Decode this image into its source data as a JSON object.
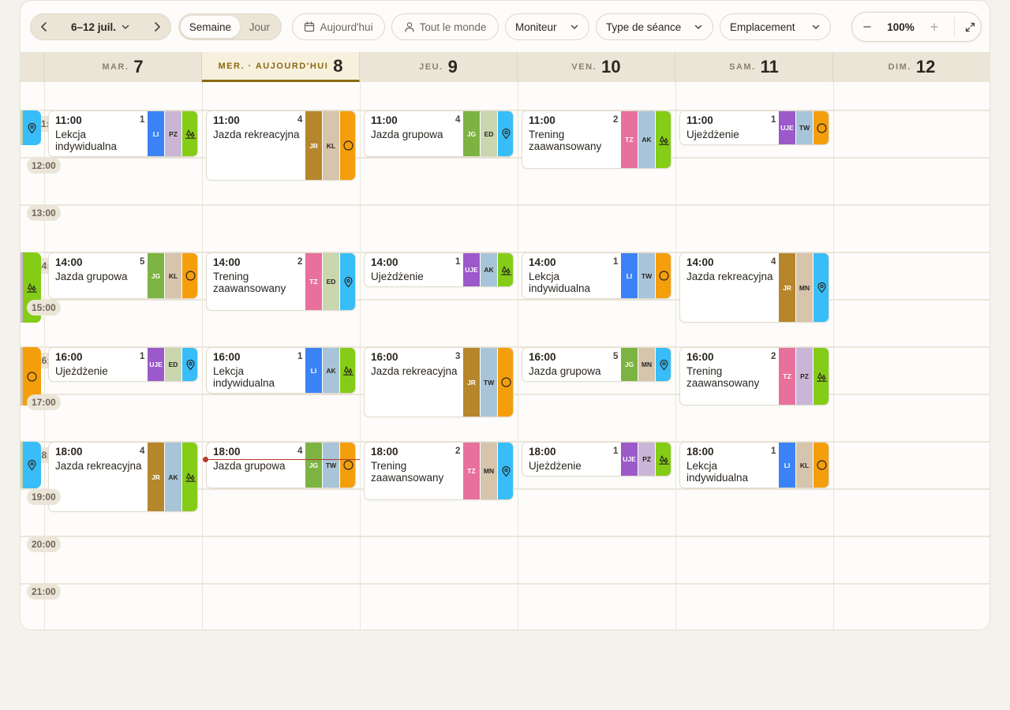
{
  "toolbar": {
    "date_range": "6–12 juil.",
    "view_week": "Semaine",
    "view_day": "Jour",
    "today_label": "Aujourd'hui",
    "people_label": "Tout le monde",
    "filter_monitor": "Moniteur",
    "filter_type": "Type de séance",
    "filter_location": "Emplacement",
    "zoom_value": "100%"
  },
  "days": [
    {
      "name": "MAR.",
      "number": "7"
    },
    {
      "name": "MER. · AUJOURD'HUI",
      "number": "8"
    },
    {
      "name": "JEU.",
      "number": "9"
    },
    {
      "name": "VEN.",
      "number": "10"
    },
    {
      "name": "SAM.",
      "number": "11"
    },
    {
      "name": "DIM.",
      "number": "12"
    }
  ],
  "time_labels": [
    "12:00",
    "13:00",
    "15:00",
    "17:00",
    "19:00",
    "20:00",
    "21:00"
  ],
  "partial_time_labels": [
    "11:",
    "14:",
    "16:",
    "18:"
  ],
  "colors": {
    "LI": "#3b82f6",
    "PZ": "#c9b6d6",
    "KL": "#d6c4ac",
    "JR": "#b5862b",
    "JG": "#7cb342",
    "ED": "#c9d6ae",
    "TZ": "#e8709c",
    "AK": "#a8c4d8",
    "UJE": "#9b59c9",
    "TW": "#a8c4d8",
    "MN": "#d6c4ac",
    "icon_green": "#84cc16",
    "icon_blue": "#38bdf8",
    "icon_orange": "#f59e0b",
    "now_line": "#b23c2a",
    "accent_today": "#8a6a12"
  },
  "events": [
    {
      "day": 0,
      "time": "11:00",
      "count": "1",
      "name": "Lekcja indywidualna",
      "tags": [
        "LI",
        "PZ"
      ],
      "icon": "trees"
    },
    {
      "day": 1,
      "time": "11:00",
      "count": "4",
      "name": "Jazda rekreacyjna",
      "tags": [
        "JR",
        "KL"
      ],
      "icon": "circle"
    },
    {
      "day": 2,
      "time": "11:00",
      "count": "4",
      "name": "Jazda grupowa",
      "tags": [
        "JG",
        "ED"
      ],
      "icon": "pin"
    },
    {
      "day": 3,
      "time": "11:00",
      "count": "2",
      "name": "Trening zaawansowany",
      "tags": [
        "TZ",
        "AK"
      ],
      "icon": "trees"
    },
    {
      "day": 4,
      "time": "11:00",
      "count": "1",
      "name": "Ujeżdżenie",
      "tags": [
        "UJE",
        "TW"
      ],
      "icon": "circle"
    },
    {
      "day": 0,
      "time": "14:00",
      "count": "5",
      "name": "Jazda grupowa",
      "tags": [
        "JG",
        "KL"
      ],
      "icon": "circle"
    },
    {
      "day": 1,
      "time": "14:00",
      "count": "2",
      "name": "Trening zaawansowany",
      "tags": [
        "TZ",
        "ED"
      ],
      "icon": "pin"
    },
    {
      "day": 2,
      "time": "14:00",
      "count": "1",
      "name": "Ujeżdżenie",
      "tags": [
        "UJE",
        "AK"
      ],
      "icon": "trees"
    },
    {
      "day": 3,
      "time": "14:00",
      "count": "1",
      "name": "Lekcja indywidualna",
      "tags": [
        "LI",
        "TW"
      ],
      "icon": "circle"
    },
    {
      "day": 4,
      "time": "14:00",
      "count": "4",
      "name": "Jazda rekreacyjna",
      "tags": [
        "JR",
        "MN"
      ],
      "icon": "pin"
    },
    {
      "day": 0,
      "time": "16:00",
      "count": "1",
      "name": "Ujeżdżenie",
      "tags": [
        "UJE",
        "ED"
      ],
      "icon": "pin"
    },
    {
      "day": 1,
      "time": "16:00",
      "count": "1",
      "name": "Lekcja indywidualna",
      "tags": [
        "LI",
        "AK"
      ],
      "icon": "trees"
    },
    {
      "day": 2,
      "time": "16:00",
      "count": "3",
      "name": "Jazda rekreacyjna",
      "tags": [
        "JR",
        "TW"
      ],
      "icon": "circle"
    },
    {
      "day": 3,
      "time": "16:00",
      "count": "5",
      "name": "Jazda grupowa",
      "tags": [
        "JG",
        "MN"
      ],
      "icon": "pin"
    },
    {
      "day": 4,
      "time": "16:00",
      "count": "2",
      "name": "Trening zaawansowany",
      "tags": [
        "TZ",
        "PZ"
      ],
      "icon": "trees"
    },
    {
      "day": 0,
      "time": "18:00",
      "count": "4",
      "name": "Jazda rekreacyjna",
      "tags": [
        "JR",
        "AK"
      ],
      "icon": "trees"
    },
    {
      "day": 1,
      "time": "18:00",
      "count": "4",
      "name": "Jazda grupowa",
      "tags": [
        "JG",
        "TW"
      ],
      "icon": "circle"
    },
    {
      "day": 2,
      "time": "18:00",
      "count": "2",
      "name": "Trening zaawansowany",
      "tags": [
        "TZ",
        "MN"
      ],
      "icon": "pin"
    },
    {
      "day": 3,
      "time": "18:00",
      "count": "1",
      "name": "Ujeżdżenie",
      "tags": [
        "UJE",
        "PZ"
      ],
      "icon": "trees"
    },
    {
      "day": 4,
      "time": "18:00",
      "count": "1",
      "name": "Lekcja indywidualna",
      "tags": [
        "LI",
        "KL"
      ],
      "icon": "circle"
    }
  ]
}
